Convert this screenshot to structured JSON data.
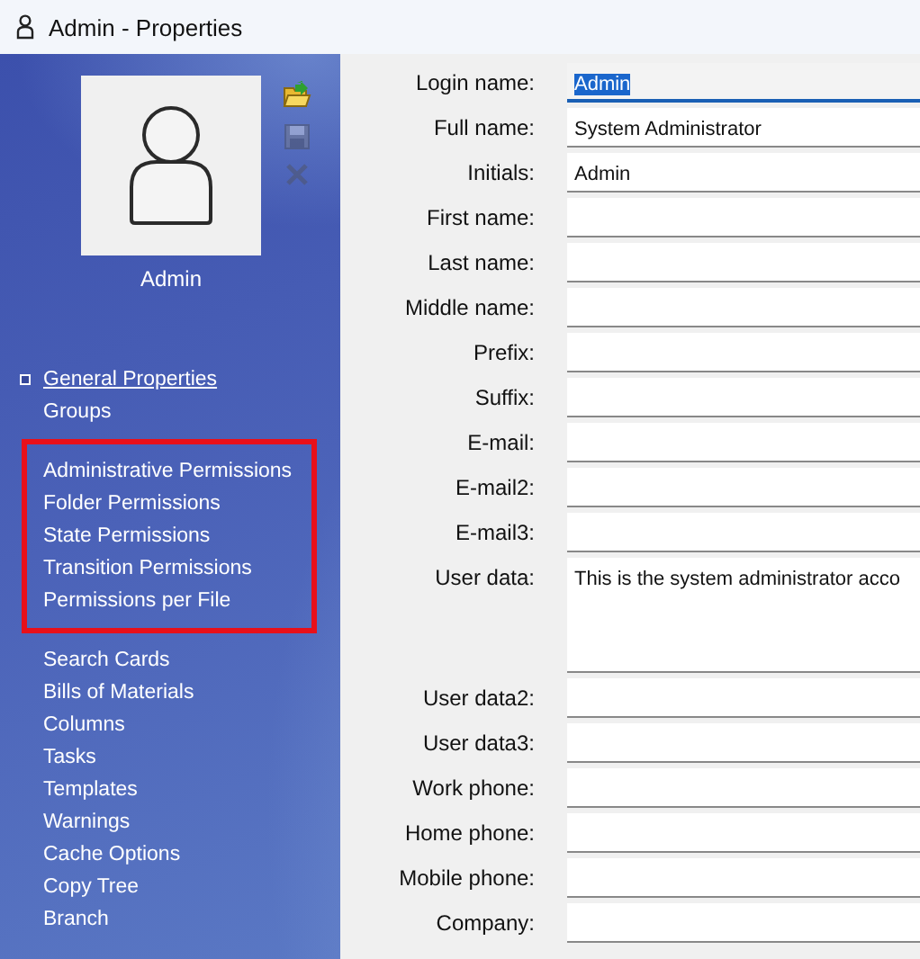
{
  "window": {
    "title": "Admin - Properties"
  },
  "profile": {
    "name": "Admin"
  },
  "toolbar": [
    {
      "kind": "open",
      "disabled": false
    },
    {
      "kind": "save",
      "disabled": true
    },
    {
      "kind": "delete",
      "disabled": true
    }
  ],
  "sidebar": {
    "groups": [
      {
        "highlighted": false,
        "items": [
          {
            "label": "General Properties",
            "selected": true
          },
          {
            "label": "Groups",
            "selected": false
          }
        ]
      },
      {
        "highlighted": true,
        "items": [
          {
            "label": "Administrative Permissions",
            "selected": false
          },
          {
            "label": "Folder Permissions",
            "selected": false
          },
          {
            "label": "State Permissions",
            "selected": false
          },
          {
            "label": "Transition Permissions",
            "selected": false
          },
          {
            "label": "Permissions per File",
            "selected": false
          }
        ]
      },
      {
        "highlighted": false,
        "items": [
          {
            "label": "Search Cards",
            "selected": false
          },
          {
            "label": "Bills of Materials",
            "selected": false
          },
          {
            "label": "Columns",
            "selected": false
          },
          {
            "label": "Tasks",
            "selected": false
          },
          {
            "label": "Templates",
            "selected": false
          },
          {
            "label": "Warnings",
            "selected": false
          },
          {
            "label": "Cache Options",
            "selected": false
          },
          {
            "label": "Copy Tree",
            "selected": false
          },
          {
            "label": "Branch",
            "selected": false
          }
        ]
      }
    ]
  },
  "form": {
    "fields": [
      {
        "label": "Login name:",
        "kind": "line",
        "value": "Admin",
        "focused": true
      },
      {
        "label": "Full name:",
        "kind": "line",
        "value": "System Administrator",
        "focused": false
      },
      {
        "label": "Initials:",
        "kind": "line",
        "value": "Admin",
        "focused": false
      },
      {
        "label": "First name:",
        "kind": "line",
        "focused": false
      },
      {
        "label": "Last name:",
        "kind": "line",
        "focused": false
      },
      {
        "label": "Middle name:",
        "kind": "line",
        "focused": false
      },
      {
        "label": "Prefix:",
        "kind": "line",
        "focused": false
      },
      {
        "label": "Suffix:",
        "kind": "line",
        "focused": false
      },
      {
        "label": "E-mail:",
        "kind": "line",
        "focused": false
      },
      {
        "label": "E-mail2:",
        "kind": "line",
        "focused": false
      },
      {
        "label": "E-mail3:",
        "kind": "line",
        "focused": false
      },
      {
        "label": "User data:",
        "kind": "multiline",
        "value": "This is the system administrator acco",
        "focused": false
      },
      {
        "label": "User data2:",
        "kind": "line",
        "focused": false
      },
      {
        "label": "User data3:",
        "kind": "line",
        "focused": false
      },
      {
        "label": "Work phone:",
        "kind": "line",
        "focused": false
      },
      {
        "label": "Home phone:",
        "kind": "line",
        "focused": false
      },
      {
        "label": "Mobile phone:",
        "kind": "line",
        "focused": false
      },
      {
        "label": "Company:",
        "kind": "line",
        "focused": false
      }
    ]
  }
}
